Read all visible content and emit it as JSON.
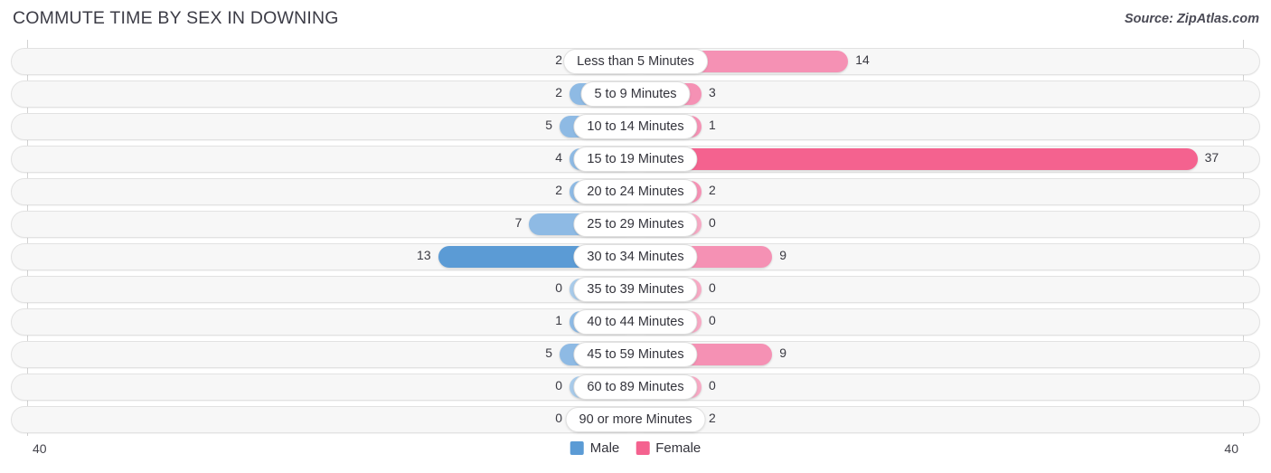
{
  "header": {
    "title": "COMMUTE TIME BY SEX IN DOWNING",
    "source": "Source: ZipAtlas.com"
  },
  "footer": {
    "tick_left": "40",
    "tick_right": "40"
  },
  "legend": {
    "items": [
      {
        "label": "Male",
        "color": "#5B9BD5"
      },
      {
        "label": "Female",
        "color": "#F4628F"
      }
    ]
  },
  "colors": {
    "male_light": "#A8CBEA",
    "male_mid": "#8EBAE4",
    "male_strong": "#5B9BD5",
    "female_light": "#F7A9C4",
    "female_mid": "#F591B4",
    "female_strong": "#F4628F",
    "track_bg": "#F7F7F7",
    "track_border": "#E2E2E2",
    "axis": "#D2D2D2"
  },
  "chart_data": {
    "type": "bar",
    "title": "COMMUTE TIME BY SEX IN DOWNING",
    "subtitle": "Source: ZipAtlas.com",
    "orientation": "horizontal-diverging",
    "xlabel": "",
    "ylabel": "",
    "xlim": [
      -40,
      40
    ],
    "axis_ticks": [
      "40",
      "40"
    ],
    "grid": false,
    "legend_position": "bottom-center",
    "categories": [
      "Less than 5 Minutes",
      "5 to 9 Minutes",
      "10 to 14 Minutes",
      "15 to 19 Minutes",
      "20 to 24 Minutes",
      "25 to 29 Minutes",
      "30 to 34 Minutes",
      "35 to 39 Minutes",
      "40 to 44 Minutes",
      "45 to 59 Minutes",
      "60 to 89 Minutes",
      "90 or more Minutes"
    ],
    "series": [
      {
        "name": "Male",
        "color": "#5B9BD5",
        "values": [
          2,
          2,
          5,
          4,
          2,
          7,
          13,
          0,
          1,
          5,
          0,
          0
        ]
      },
      {
        "name": "Female",
        "color": "#F4628F",
        "values": [
          14,
          3,
          1,
          37,
          2,
          0,
          9,
          0,
          0,
          9,
          0,
          2
        ]
      }
    ]
  }
}
